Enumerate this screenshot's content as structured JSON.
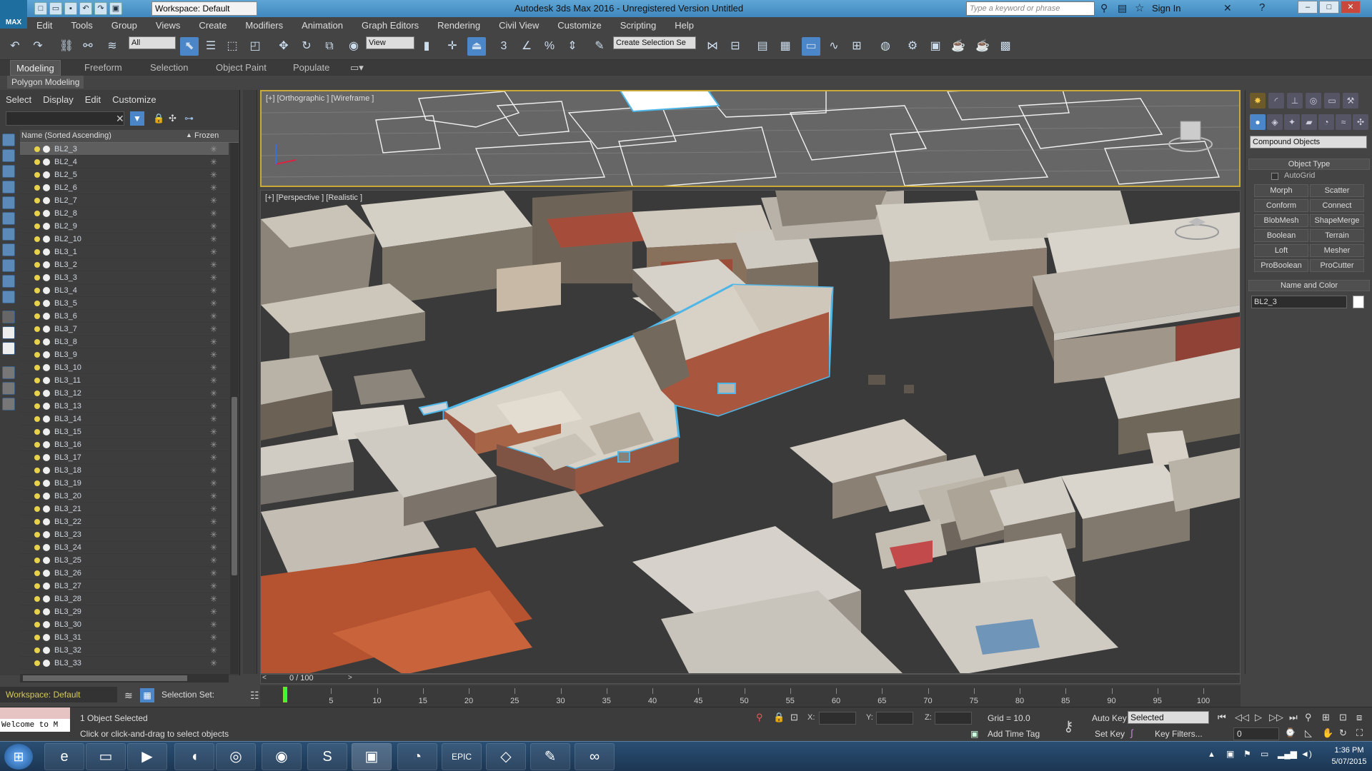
{
  "app": {
    "logo_text": "MAX",
    "title": "Autodesk 3ds Max 2016 - Unregistered Version   Untitled",
    "workspace": "Workspace: Default",
    "search_placeholder": "Type a keyword or phrase",
    "sign_in": "Sign In"
  },
  "menu": [
    "Edit",
    "Tools",
    "Group",
    "Views",
    "Create",
    "Modifiers",
    "Animation",
    "Graph Editors",
    "Rendering",
    "Civil View",
    "Customize",
    "Scripting",
    "Help"
  ],
  "toolbar": {
    "filter_all": "All",
    "ref_coord": "View",
    "selection_set_placeholder": "Create Selection Se"
  },
  "ribbon": {
    "tabs": [
      "Modeling",
      "Freeform",
      "Selection",
      "Object Paint",
      "Populate"
    ],
    "active_tab": "Modeling",
    "sub_label": "Polygon Modeling"
  },
  "scene_explorer": {
    "menu": [
      "Select",
      "Display",
      "Edit",
      "Customize"
    ],
    "col_name": "Name (Sorted Ascending)",
    "col_frozen": "Frozen",
    "items": [
      "BL2_3",
      "BL2_4",
      "BL2_5",
      "BL2_6",
      "BL2_7",
      "BL2_8",
      "BL2_9",
      "BL2_10",
      "BL3_1",
      "BL3_2",
      "BL3_3",
      "BL3_4",
      "BL3_5",
      "BL3_6",
      "BL3_7",
      "BL3_8",
      "BL3_9",
      "BL3_10",
      "BL3_11",
      "BL3_12",
      "BL3_13",
      "BL3_14",
      "BL3_15",
      "BL3_16",
      "BL3_17",
      "BL3_18",
      "BL3_19",
      "BL3_20",
      "BL3_21",
      "BL3_22",
      "BL3_23",
      "BL3_24",
      "BL3_25",
      "BL3_26",
      "BL3_27",
      "BL3_28",
      "BL3_29",
      "BL3_30",
      "BL3_31",
      "BL3_32",
      "BL3_33"
    ],
    "selected": "BL2_3",
    "workspace_footer": "Workspace: Default",
    "selection_set_label": "Selection Set:"
  },
  "viewports": {
    "top_label": "[+] [Orthographic ] [Wireframe ]",
    "persp_label": "[+] [Perspective ] [Realistic ]"
  },
  "command_panel": {
    "category": "Compound Objects",
    "object_type_title": "Object Type",
    "autogrid": "AutoGrid",
    "buttons": [
      "Morph",
      "Scatter",
      "Conform",
      "Connect",
      "BlobMesh",
      "ShapeMerge",
      "Boolean",
      "Terrain",
      "Loft",
      "Mesher",
      "ProBoolean",
      "ProCutter"
    ],
    "name_color_title": "Name and Color",
    "object_name": "BL2_3"
  },
  "timeline": {
    "frame_display": "0 / 100",
    "ticks": [
      "5",
      "10",
      "15",
      "20",
      "25",
      "30",
      "35",
      "40",
      "45",
      "50",
      "55",
      "60",
      "65",
      "70",
      "75",
      "80",
      "85",
      "90",
      "95",
      "100"
    ]
  },
  "status": {
    "maxscript": "Welcome to M",
    "selected_count": "1 Object Selected",
    "prompt": "Click or click-and-drag to select objects",
    "x_label": "X:",
    "y_label": "Y:",
    "z_label": "Z:",
    "grid": "Grid = 10.0",
    "add_time_tag": "Add Time Tag",
    "auto_key": "Auto Key",
    "set_key": "Set Key",
    "selected_dropdown": "Selected",
    "key_filters": "Key Filters...",
    "frame_value": "0"
  },
  "taskbar": {
    "time": "1:36 PM",
    "date": "5/07/2015"
  },
  "colors": {
    "selection_outline": "#4fb6e8",
    "viewport_active_border": "#c8a93a",
    "titlebar": "#4f97c9"
  }
}
